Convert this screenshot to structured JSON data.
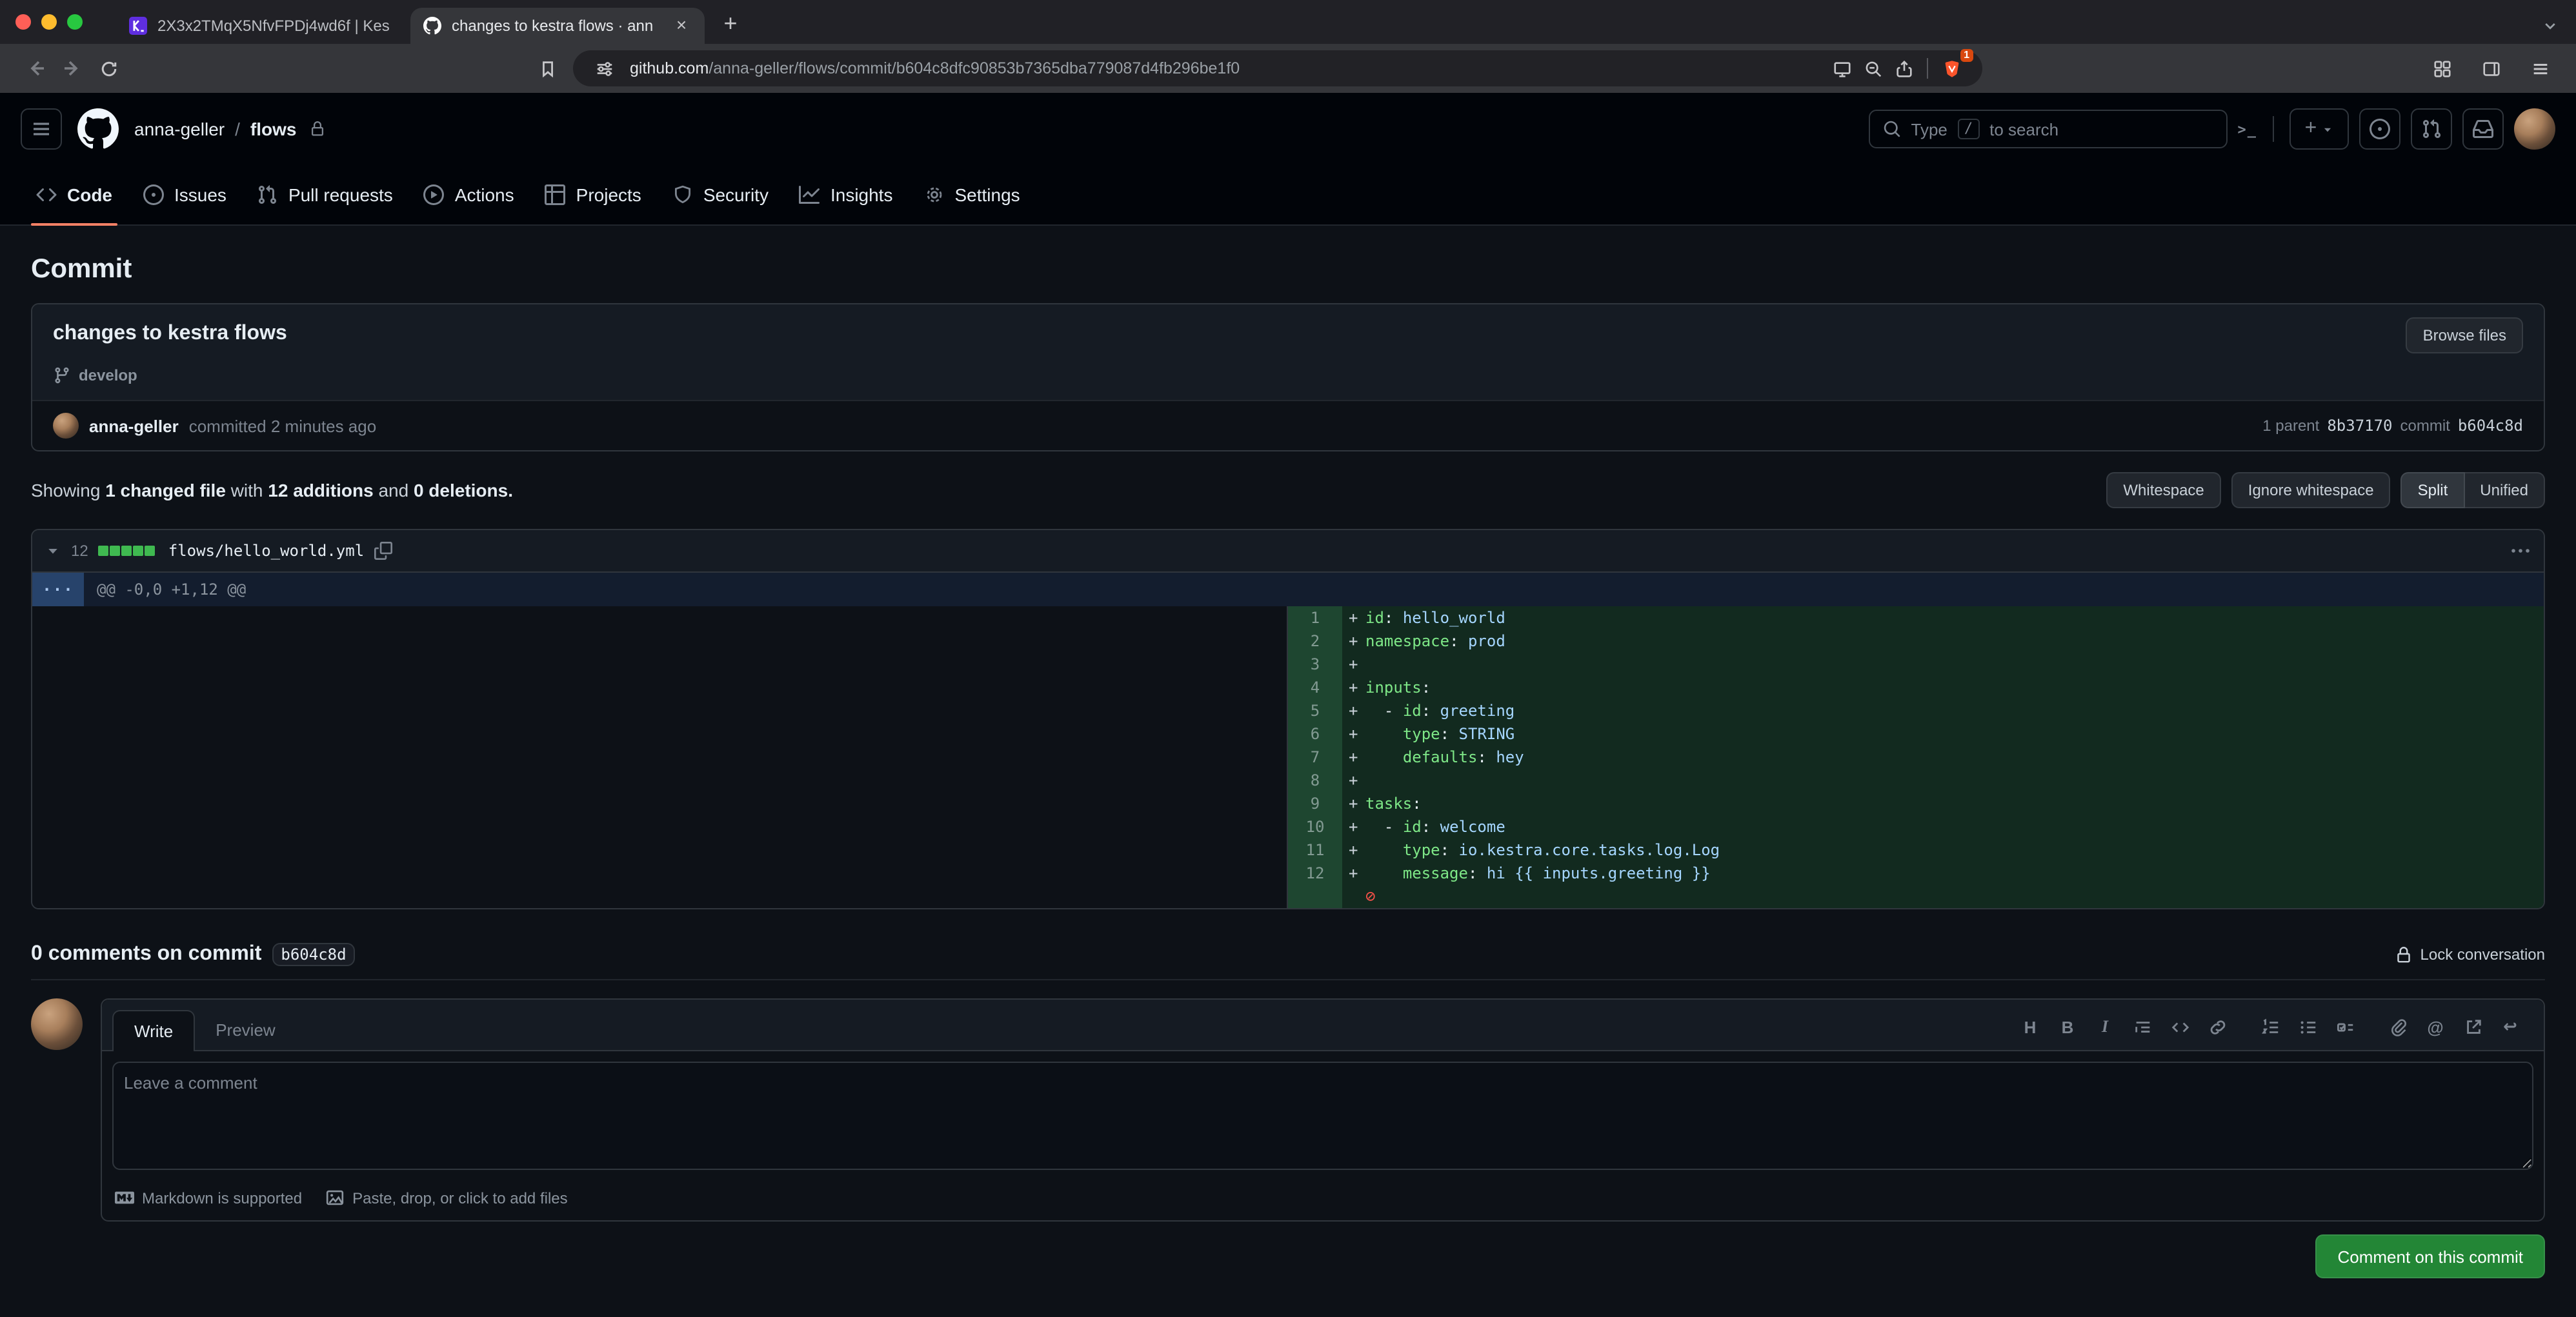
{
  "browser": {
    "tabs": [
      {
        "title": "2X3x2TMqX5NfvFPDj4wd6f | Kes"
      },
      {
        "title": "changes to kestra flows · ann"
      }
    ],
    "url": {
      "domain": "github.com",
      "path": "/anna-geller/flows/commit/b604c8dfc90853b7365dba779087d4fb296be1f0"
    },
    "shield_badge": "1"
  },
  "header": {
    "owner": "anna-geller",
    "separator": "/",
    "repo": "flows",
    "search": {
      "pre": "Type",
      "key": "/",
      "post": "to search"
    }
  },
  "repo_nav": {
    "items": [
      {
        "label": "Code"
      },
      {
        "label": "Issues"
      },
      {
        "label": "Pull requests"
      },
      {
        "label": "Actions"
      },
      {
        "label": "Projects"
      },
      {
        "label": "Security"
      },
      {
        "label": "Insights"
      },
      {
        "label": "Settings"
      }
    ]
  },
  "commit_page": {
    "heading": "Commit",
    "commit_title": "changes to kestra flows",
    "browse_files_label": "Browse files",
    "branch": "develop",
    "author": "anna-geller",
    "committed": "committed 2 minutes ago",
    "parent_label": "1 parent",
    "parent_sha": "8b37170",
    "commit_label": "commit",
    "commit_sha": "b604c8d",
    "summary": {
      "showing": "Showing",
      "changed": "1 changed file",
      "with": "with",
      "additions": "12 additions",
      "and": "and",
      "deletions": "0 deletions."
    },
    "controls": {
      "whitespace": "Whitespace",
      "ignore": "Ignore whitespace",
      "split": "Split",
      "unified": "Unified"
    }
  },
  "diff": {
    "stat_count": "12",
    "filename": "flows/hello_world.yml",
    "expander": "···",
    "hunk_header": "@@ -0,0 +1,12 @@",
    "line_start": 1,
    "addition_marker": "+",
    "no_newline_symbol": "⊘",
    "lines": [
      "id: hello_world",
      "namespace: prod",
      "",
      "inputs:",
      "  - id: greeting",
      "    type: STRING",
      "    defaults: hey",
      "",
      "tasks:",
      "  - id: welcome",
      "    type: io.kestra.core.tasks.log.Log",
      "    message: hi {{ inputs.greeting }}"
    ]
  },
  "comments": {
    "heading": "0 comments on commit",
    "sha_chip": "b604c8d",
    "lock_label": "Lock conversation",
    "tab_write": "Write",
    "tab_preview": "Preview",
    "placeholder": "Leave a comment",
    "markdown_hint": "Markdown is supported",
    "paste_hint": "Paste, drop, or click to add files",
    "submit_label": "Comment on this commit"
  },
  "icons": {
    "close_tab": "×",
    "new_tab": "+",
    "command_palette": ">_",
    "heading": "H",
    "bold": "B",
    "italic": "I",
    "mention": "@",
    "reply": "↩"
  }
}
